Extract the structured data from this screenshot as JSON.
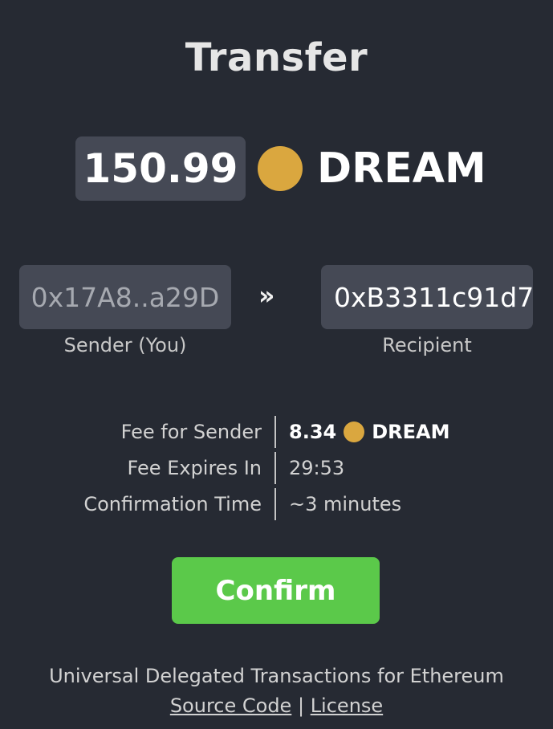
{
  "title": "Transfer",
  "amount": {
    "value": "150.99",
    "token": "DREAM",
    "coin_color": "#daa73f"
  },
  "sender": {
    "address": "0x17A8..a29D",
    "label": "Sender (You)"
  },
  "arrows": "››",
  "recipient": {
    "address": "0xB3311c91d7",
    "label": "Recipient"
  },
  "fees": [
    {
      "key": "Fee for Sender",
      "value": "8.34",
      "token": "DREAM"
    },
    {
      "key": "Fee Expires In",
      "value": "29:53"
    },
    {
      "key": "Confirmation Time",
      "value": "~3 minutes"
    }
  ],
  "confirm_label": "Confirm",
  "confirm_color": "#5bc94a",
  "footer": {
    "tagline": "Universal Delegated Transactions for Ethereum",
    "links": [
      "Source Code",
      "License"
    ],
    "separator": "|"
  }
}
